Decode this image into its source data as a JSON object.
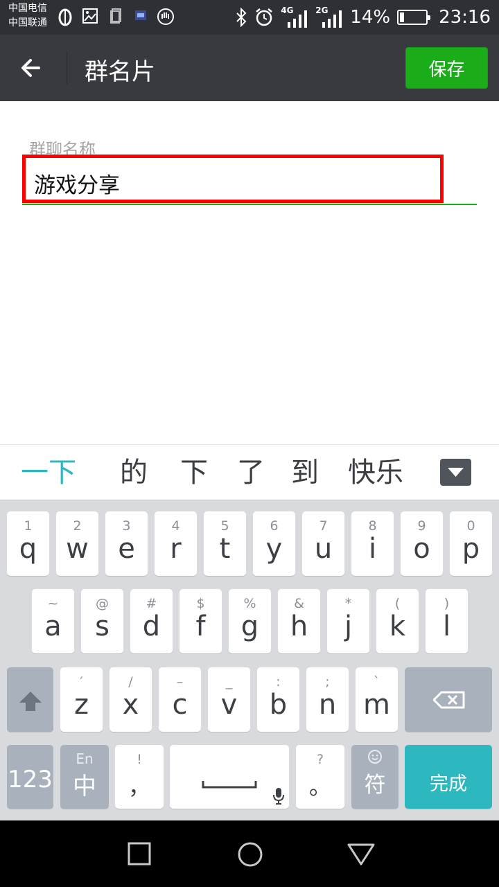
{
  "status_bar": {
    "carrier1": "中国电信",
    "carrier2": "中国联通",
    "net1": "4G",
    "net2": "2G",
    "battery_pct": "14%",
    "battery_level": 0.14,
    "time": "23:16",
    "icons": [
      "sync-icon",
      "image-icon",
      "clipboard-icon",
      "app-icon",
      "hand-icon",
      "bluetooth-icon",
      "alarm-icon",
      "signal-icon",
      "signal-icon",
      "battery-icon"
    ]
  },
  "header": {
    "title": "群名片",
    "save_label": "保存"
  },
  "form": {
    "label": "群聊名称",
    "value": "游戏分享"
  },
  "candidates": [
    "一下",
    "的",
    "下",
    "了",
    "到",
    "快乐"
  ],
  "keyboard": {
    "row1": [
      {
        "sub": "1",
        "main": "q"
      },
      {
        "sub": "2",
        "main": "w"
      },
      {
        "sub": "3",
        "main": "e"
      },
      {
        "sub": "4",
        "main": "r"
      },
      {
        "sub": "5",
        "main": "t"
      },
      {
        "sub": "6",
        "main": "y"
      },
      {
        "sub": "7",
        "main": "u"
      },
      {
        "sub": "8",
        "main": "i"
      },
      {
        "sub": "9",
        "main": "o"
      },
      {
        "sub": "0",
        "main": "p"
      }
    ],
    "row2": [
      {
        "sub": "~",
        "main": "a"
      },
      {
        "sub": "@",
        "main": "s"
      },
      {
        "sub": "#",
        "main": "d"
      },
      {
        "sub": "$",
        "main": "f"
      },
      {
        "sub": "%",
        "main": "g"
      },
      {
        "sub": "&",
        "main": "h"
      },
      {
        "sub": "*",
        "main": "j"
      },
      {
        "sub": "(",
        "main": "k"
      },
      {
        "sub": ")",
        "main": "l"
      }
    ],
    "row3": [
      {
        "sub": "′",
        "main": "z"
      },
      {
        "sub": "/",
        "main": "x"
      },
      {
        "sub": "–",
        "main": "c"
      },
      {
        "sub": "_",
        "main": "v"
      },
      {
        "sub": ":",
        "main": "b"
      },
      {
        "sub": ";",
        "main": "n"
      },
      {
        "sub": "`",
        "main": "m"
      }
    ],
    "num_label": "123",
    "lang_en": "En",
    "lang_zh": "中",
    "comma_sub": "!",
    "comma_main": "，",
    "period_sub": "?",
    "period_main": "。",
    "symbol_label": "符",
    "done_label": "完成"
  },
  "colors": {
    "accent_green": "#1aad19",
    "candidate_highlight": "#31b5c0",
    "done_key": "#2db8c0",
    "highlight_border": "#ff0000"
  }
}
